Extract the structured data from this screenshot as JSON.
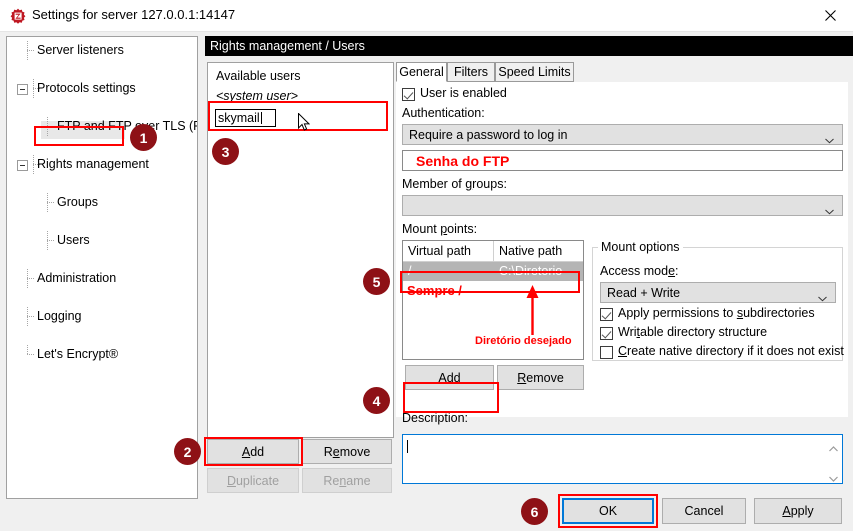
{
  "window": {
    "title": "Settings for server 127.0.0.1:14147",
    "app_icon": "filezilla-server-icon",
    "close_label": "✕"
  },
  "sidebar": {
    "items": [
      {
        "label": "Server listeners",
        "level": 1,
        "expander": false,
        "selected": false
      },
      {
        "label": "Protocols settings",
        "level": 0,
        "expander": true,
        "selected": false
      },
      {
        "label": "FTP and FTP over TLS (FTPS)",
        "level": 2,
        "expander": false,
        "selected": false
      },
      {
        "label": "Rights management",
        "level": 0,
        "expander": true,
        "selected": false
      },
      {
        "label": "Groups",
        "level": 2,
        "expander": false,
        "selected": false
      },
      {
        "label": "Users",
        "level": 2,
        "expander": false,
        "selected": true
      },
      {
        "label": "Administration",
        "level": 1,
        "expander": false,
        "selected": false
      },
      {
        "label": "Logging",
        "level": 1,
        "expander": false,
        "selected": false
      },
      {
        "label": "Let's Encrypt®",
        "level": 1,
        "expander": false,
        "selected": false
      }
    ]
  },
  "header": {
    "title": "Rights management / Users"
  },
  "users": {
    "panel_title": "Available users",
    "system_user": "<system user>",
    "editing_value": "skymail",
    "buttons": {
      "add": "Add",
      "remove": "Remove",
      "duplicate": "Duplicate",
      "rename": "Rename"
    }
  },
  "tabs": [
    {
      "label": "General",
      "active": true
    },
    {
      "label": "Filters",
      "active": false
    },
    {
      "label": "Speed Limits",
      "active": false
    }
  ],
  "general": {
    "user_enabled_label": "User is enabled",
    "user_enabled_checked": true,
    "authentication_label": "Authentication:",
    "authentication_value": "Require a password to log in",
    "password_annotation": "Senha do FTP",
    "member_of_groups_label": "Member of groups:",
    "member_of_groups_value": "",
    "mount_points_label": "Mount points:",
    "mount_grid": {
      "columns": [
        "Virtual path",
        "Native path"
      ],
      "rows": [
        [
          "/",
          "C:\\Diretorio"
        ]
      ]
    },
    "mount_annotation_left": "Sempre /",
    "mount_annotation_arrow": "Diretório desejado",
    "mount_buttons": {
      "add": "Add",
      "remove": "Remove"
    },
    "mount_options": {
      "group_label": "Mount options",
      "access_mode_label": "Access mode:",
      "access_mode_value": "Read + Write",
      "checkboxes": [
        {
          "label": "Apply permissions to subdirectories",
          "checked": true
        },
        {
          "label": "Writable directory structure",
          "checked": true
        },
        {
          "label": "Create native directory if it does not exist",
          "checked": false
        }
      ]
    },
    "description_label": "Description:",
    "description_value": ""
  },
  "footer": {
    "ok": "OK",
    "cancel": "Cancel",
    "apply": "Apply"
  },
  "annotations": {
    "badges": [
      "1",
      "2",
      "3",
      "4",
      "5",
      "6"
    ],
    "accent_color": "#ff0000",
    "badge_color": "#8e1116"
  }
}
